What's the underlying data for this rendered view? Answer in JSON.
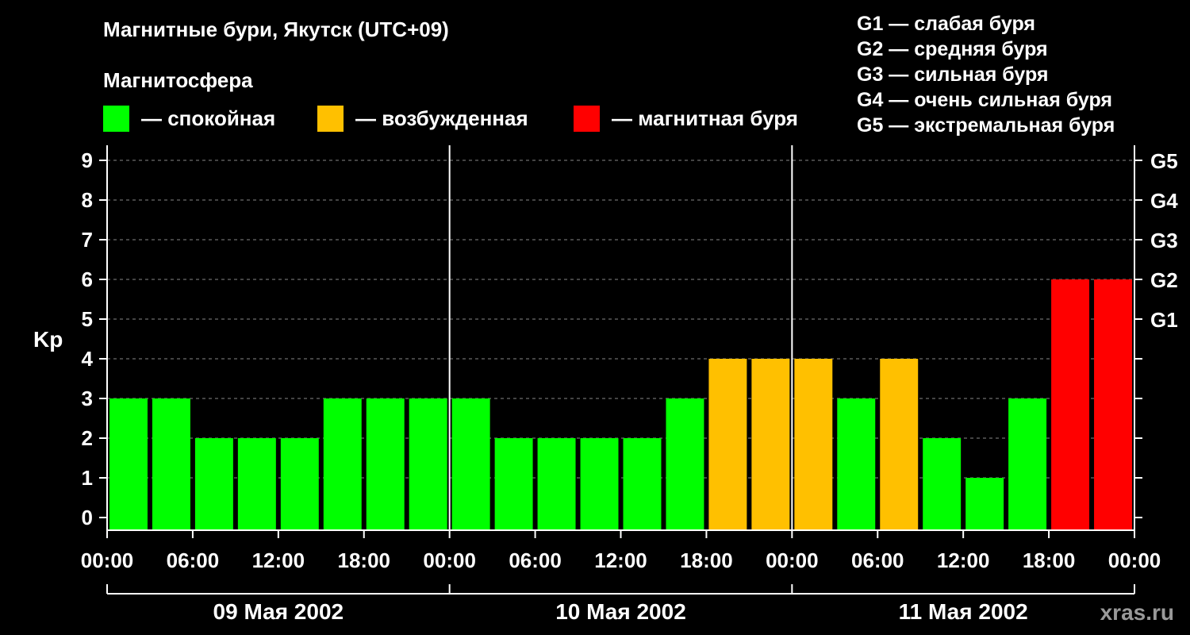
{
  "title": "Магнитные бури, Якутск (UTC+09)",
  "subtitle": "Магнитосфера",
  "legend": [
    {
      "label": "— спокойная",
      "color": "#00ff00"
    },
    {
      "label": "— возбужденная",
      "color": "#ffc000"
    },
    {
      "label": "— магнитная буря",
      "color": "#ff0000"
    }
  ],
  "g_legend": [
    "G1 — слабая буря",
    "G2 — средняя буря",
    "G3 — сильная буря",
    "G4 — очень сильная буря",
    "G5 — экстремальная буря"
  ],
  "watermark": "xras.ru",
  "colors": {
    "calm": "#00ff00",
    "excited": "#ffc000",
    "storm": "#ff0000",
    "background": "#000000",
    "grid": "#888888"
  },
  "chart_data": {
    "type": "bar",
    "ylabel": "Kp",
    "ylim": [
      0,
      9
    ],
    "yticks": [
      "0",
      "1",
      "2",
      "3",
      "4",
      "5",
      "6",
      "7",
      "8",
      "9"
    ],
    "right_ticks": [
      {
        "kp": 5,
        "label": "G1"
      },
      {
        "kp": 6,
        "label": "G2"
      },
      {
        "kp": 7,
        "label": "G3"
      },
      {
        "kp": 8,
        "label": "G4"
      },
      {
        "kp": 9,
        "label": "G5"
      }
    ],
    "grid": "dashed horizontal",
    "xticks": [
      "00:00",
      "06:00",
      "12:00",
      "18:00",
      "00:00",
      "06:00",
      "12:00",
      "18:00",
      "00:00",
      "06:00",
      "12:00",
      "18:00",
      "00:00"
    ],
    "days": [
      "09 Мая 2002",
      "10 Мая 2002",
      "11 Мая 2002"
    ],
    "values": [
      3,
      3,
      2,
      2,
      2,
      3,
      3,
      3,
      3,
      2,
      2,
      2,
      2,
      3,
      4,
      4,
      4,
      3,
      4,
      2,
      1,
      3,
      6,
      6
    ],
    "levels": [
      "calm",
      "calm",
      "calm",
      "calm",
      "calm",
      "calm",
      "calm",
      "calm",
      "calm",
      "calm",
      "calm",
      "calm",
      "calm",
      "calm",
      "excited",
      "excited",
      "excited",
      "calm",
      "excited",
      "calm",
      "calm",
      "calm",
      "storm",
      "storm"
    ]
  }
}
